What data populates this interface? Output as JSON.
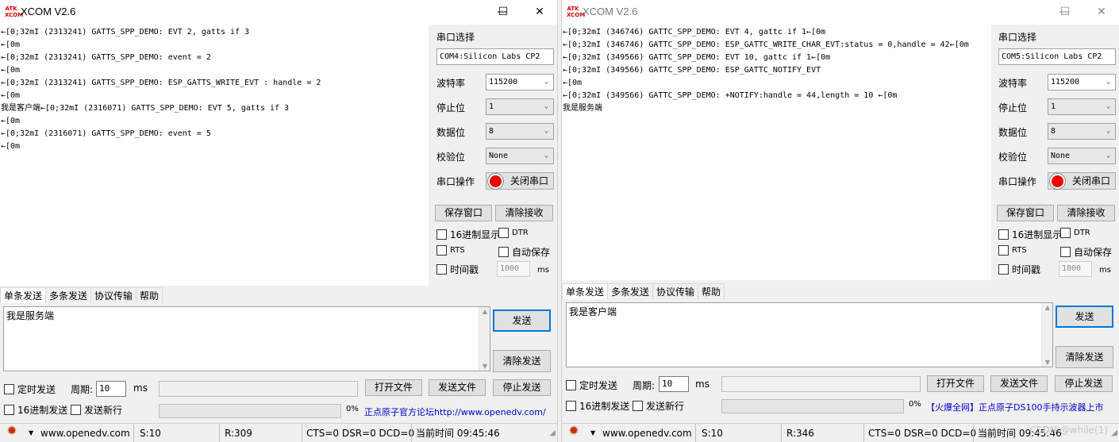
{
  "windows": [
    {
      "title": "XCOM V2.6",
      "logo_text": "ATK XCOM",
      "controls": {
        "minimize": "—",
        "maximize": "☐",
        "close": "✕"
      },
      "receive_text": "←[0;32mI (2313241) GATTS_SPP_DEMO: EVT 2, gatts if 3\n←[0m\n←[0;32mI (2313241) GATTS_SPP_DEMO: event = 2\n←[0m\n←[0;32mI (2313241) GATTS_SPP_DEMO: ESP_GATTS_WRITE_EVT : handle = 2\n←[0m\n我是客户端←[0;32mI (2316071) GATTS_SPP_DEMO: EVT 5, gatts if 3\n←[0m\n←[0;32mI (2316071) GATTS_SPP_DEMO: event = 5\n←[0m",
      "serial": {
        "port_label": "串口选择",
        "port_value": "COM4:Silicon Labs CP2",
        "baud_label": "波特率",
        "baud_value": "115200",
        "stopbit_label": "停止位",
        "stopbit_value": "1",
        "databit_label": "数据位",
        "databit_value": "8",
        "parity_label": "校验位",
        "parity_value": "None",
        "op_label": "串口操作",
        "op_button": "关闭串口",
        "save_window": "保存窗口",
        "clear_recv": "清除接收",
        "hex_display": "16进制显示",
        "dtr": "DTR",
        "rts": "RTS",
        "auto_save": "自动保存",
        "timestamp": "时间戳",
        "interval": "1000",
        "ms": "ms"
      },
      "tabs": [
        "单条发送",
        "多条发送",
        "协议传输",
        "帮助"
      ],
      "send_text": "我是服务端",
      "send_button": "发送",
      "clear_send_button": "清除发送",
      "timed_send": "定时发送",
      "period_label": "周期:",
      "period_value": "10",
      "period_unit": "ms",
      "open_file": "打开文件",
      "send_file": "发送文件",
      "stop_send": "停止发送",
      "hex_send": "16进制发送",
      "newline_send": "发送新行",
      "progress_percent": "0%",
      "link_text": "正点原子官方论坛http://www.openedv.com/",
      "status": {
        "url": "www.openedv.com",
        "sent": "S:10",
        "received": "R:309",
        "signals": "CTS=0 DSR=0 DCD=0",
        "time": "当前时间 09:45:46"
      }
    },
    {
      "title": "XCOM V2.6",
      "logo_text": "ATK XCOM",
      "controls": {
        "minimize": "—",
        "maximize": "☐",
        "close": "✕"
      },
      "receive_text": "←[0;32mI (346746) GATTC_SPP_DEMO: EVT 4, gattc if 1←[0m\n←[0;32mI (346746) GATTC_SPP_DEMO: ESP_GATTC_WRITE_CHAR_EVT:status = 0,handle = 42←[0m\n←[0;32mI (349566) GATTC_SPP_DEMO: EVT 10, gattc if 1←[0m\n←[0;32mI (349566) GATTC_SPP_DEMO: ESP_GATTC_NOTIFY_EVT\n←[0m\n←[0;32mI (349566) GATTC_SPP_DEMO: +NOTIFY:handle = 44,length = 10 ←[0m\n我是服务端",
      "serial": {
        "port_label": "串口选择",
        "port_value": "COM5:Silicon Labs CP2",
        "baud_label": "波特率",
        "baud_value": "115200",
        "stopbit_label": "停止位",
        "stopbit_value": "1",
        "databit_label": "数据位",
        "databit_value": "8",
        "parity_label": "校验位",
        "parity_value": "None",
        "op_label": "串口操作",
        "op_button": "关闭串口",
        "save_window": "保存窗口",
        "clear_recv": "清除接收",
        "hex_display": "16进制显示",
        "dtr": "DTR",
        "rts": "RTS",
        "auto_save": "自动保存",
        "timestamp": "时间戳",
        "interval": "1000",
        "ms": "ms"
      },
      "tabs": [
        "单条发送",
        "多条发送",
        "协议传输",
        "帮助"
      ],
      "send_text": "我是客户端",
      "send_button": "发送",
      "clear_send_button": "清除发送",
      "timed_send": "定时发送",
      "period_label": "周期:",
      "period_value": "10",
      "period_unit": "ms",
      "open_file": "打开文件",
      "send_file": "发送文件",
      "stop_send": "停止发送",
      "hex_send": "16进制发送",
      "newline_send": "发送新行",
      "progress_percent": "0%",
      "link_text": "【火爆全网】正点原子DS100手持示波器上市",
      "status": {
        "url": "www.openedv.com",
        "sent": "S:10",
        "received": "R:346",
        "signals": "CTS=0 DSR=0 DCD=0",
        "time": "当前时间 09:45:46"
      }
    }
  ],
  "watermark": "CSDN @while(1)",
  "icons": {
    "settings": "gear-icon",
    "led": "red-led-icon"
  },
  "colors": {
    "led": "#e00000",
    "link": "#0000c8",
    "focus_border": "#0078d7"
  }
}
